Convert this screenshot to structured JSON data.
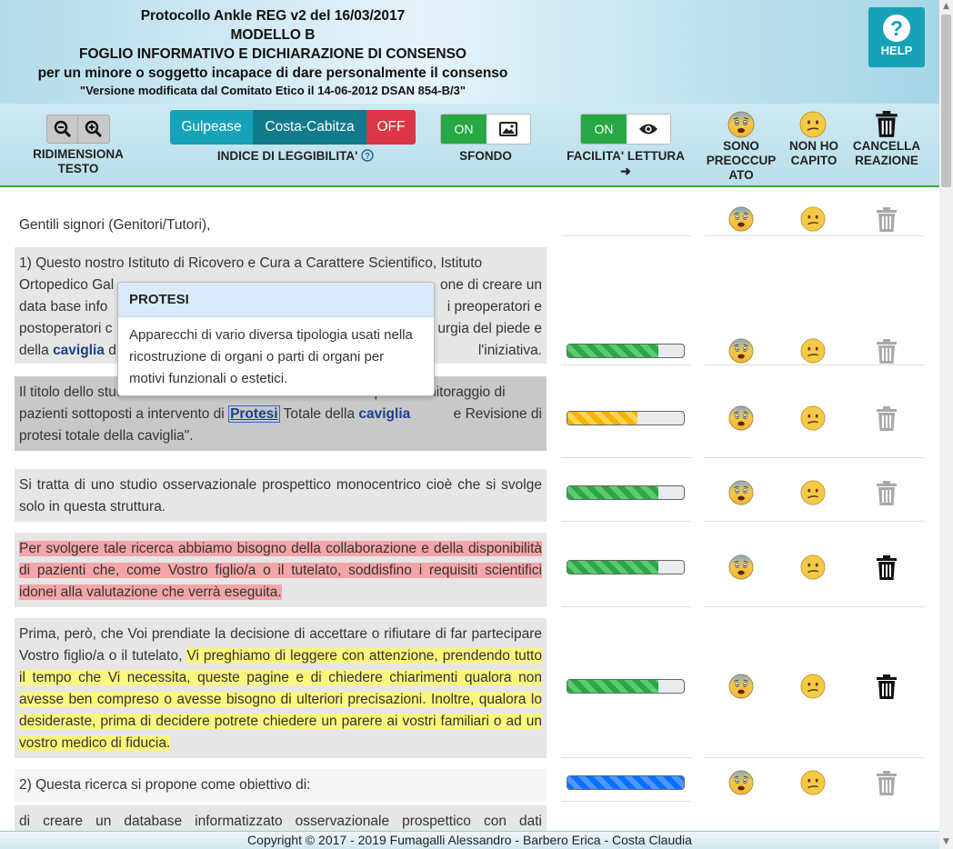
{
  "header": {
    "line1": "Protocollo Ankle REG v2 del 16/03/2017",
    "line2": "MODELLO B",
    "line3": "FOGLIO INFORMATIVO E DICHIARAZIONE DI CONSENSO",
    "line4": "per un minore o soggetto incapace di dare personalmente il consenso",
    "line5": "\"Versione modificata dal Comitato Etico il 14-06-2012 DSAN 854-B/3\"",
    "help_label": "HELP",
    "help_symbol": "?"
  },
  "toolbar": {
    "resize_label_1": "RIDIMENSIONA",
    "resize_label_2": "TESTO",
    "readability_buttons": [
      "Gulpease",
      "Costa-Cabitza",
      "OFF"
    ],
    "readability_label": "INDICE DI LEGGIBILITA'",
    "background_on": "ON",
    "background_label": "SFONDO",
    "easy_read_on": "ON",
    "easy_read_label": "FACILITA' LETTURA",
    "easy_read_arrow": "➜",
    "worried_label": [
      "SONO",
      "PREOCCUP",
      "ATO"
    ],
    "not_understood_label": [
      "NON HO",
      "CAPITO"
    ],
    "delete_label": [
      "CANCELLA",
      "REAZIONE"
    ],
    "colors": {
      "teal": "#17a2b8",
      "teal_active": "#117a8b",
      "red": "#dc3545",
      "green": "#28a745"
    }
  },
  "rows": [
    {
      "text": "Gentili signori (Genitori/Tutori),"
    },
    {
      "text_a": "1) Questo nostro Istituto di Ricovero e Cura a Carattere Scientifico, Istituto",
      "text_b": "Ortopedico Gal",
      "text_c": "one di creare un",
      "text_d": "data base info",
      "text_e": "i preoperatori e",
      "text_f": "postoperatori c",
      "text_g": "urgia del piede e",
      "text_h_pre": "della ",
      "text_h_kw": "caviglia",
      "text_h_mid": " d",
      "text_h_end": "l'iniziativa.",
      "progress": 0.78,
      "progress_color": "green"
    },
    {
      "text_a": "Il titolo dello studio \"Studio osservazionale monocentrico per il monitoraggio di",
      "text_b_pre": "pazienti sottoposti a intervento di ",
      "text_b_link": "Protesi",
      "text_b_mid": " Totale della ",
      "text_b_kw": "caviglia",
      "text_b_end": " e Revisione di",
      "text_c": "protesi totale della caviglia\".",
      "progress": 0.6,
      "progress_color": "yellow"
    },
    {
      "text": "Si tratta di uno studio osservazionale prospettico monocentrico cioè che si svolge solo in questa struttura.",
      "progress": 0.78,
      "progress_color": "green"
    },
    {
      "text": "Per svolgere tale ricerca abbiamo bisogno della collaborazione e della disponibilità di pazienti che, come Vostro figlio/a o il tutelato, soddisfino i requisiti scientifici idonei alla valutazione che verrà eseguita.",
      "progress": 0.78,
      "progress_color": "green"
    },
    {
      "text_plain": "Prima, però, che Voi prendiate la decisione di accettare o rifiutare di far partecipare Vostro figlio/a o il tutelato, ",
      "text_hl": "Vi preghiamo di leggere con attenzione, prendendo tutto il tempo che Vi necessita, queste pagine e di chiedere chiarimenti qualora non avesse ben compreso o avesse bisogno di ulteriori precisazioni. Inoltre, qualora lo desideraste, prima di decidere potrete chiedere un parere ai vostri familiari o ad un vostro medico di fiducia.",
      "progress": 0.78,
      "progress_color": "green"
    },
    {
      "text": "2) Questa ricerca si propone come obiettivo di:",
      "progress": 1.0,
      "progress_color": "blue"
    },
    {
      "text": "di creare un database informatizzato osservazionale prospettico con dati"
    }
  ],
  "tooltip": {
    "title": "PROTESI",
    "body": "Apparecchi di vario diversa tipologia usati nella ricostruzione di organi o parti di organi per motivi funzionali o estetici."
  },
  "footer": {
    "text": "Copyright © 2017 - 2019 Fumagalli Alessandro - Barbero Erica - Costa Claudia"
  }
}
